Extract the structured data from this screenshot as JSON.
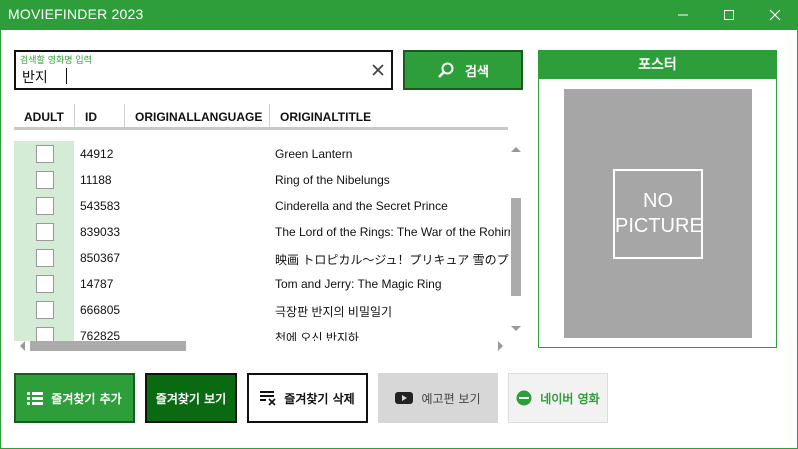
{
  "window": {
    "title": "MOVIEFINDER 2023"
  },
  "search": {
    "hint": "검색할 영화명 입력",
    "value": "반지",
    "button_label": "검색"
  },
  "table": {
    "columns": [
      "ADULT",
      "ID",
      "ORIGINALLANGUAGE",
      "ORIGINALTITLE"
    ],
    "rows": [
      {
        "id": "44912",
        "title": "Green Lantern"
      },
      {
        "id": "11188",
        "title": "Ring of the Nibelungs"
      },
      {
        "id": "543583",
        "title": "Cinderella and the Secret Prince"
      },
      {
        "id": "839033",
        "title": "The Lord of the Rings: The War of the Rohirrim"
      },
      {
        "id": "850367",
        "title": "映画 トロピカル～ジュ！プリキュア 雪のプリンセスと奇跡の指輪！"
      },
      {
        "id": "14787",
        "title": "Tom and Jerry: The Magic Ring"
      },
      {
        "id": "666805",
        "title": "극장판 반지의 비밀일기"
      },
      {
        "id": "762825",
        "title": "천에 오신 반지하"
      }
    ]
  },
  "poster": {
    "header": "포스터",
    "placeholder_line1": "NO",
    "placeholder_line2": "PICTURE"
  },
  "buttons": {
    "add_favorite": "즐겨찾기 추가",
    "view_favorites": "즐겨찾기 보기",
    "delete_favorite": "즐겨찾기 삭제",
    "view_trailer": "예고편 보기",
    "naver_movie": "네이버 영화"
  },
  "colors": {
    "accent": "#2e9e3a",
    "accent_dark": "#0a6a12",
    "adult_cell": "#d4ecd6",
    "poster_bg": "#a6a6a6"
  }
}
